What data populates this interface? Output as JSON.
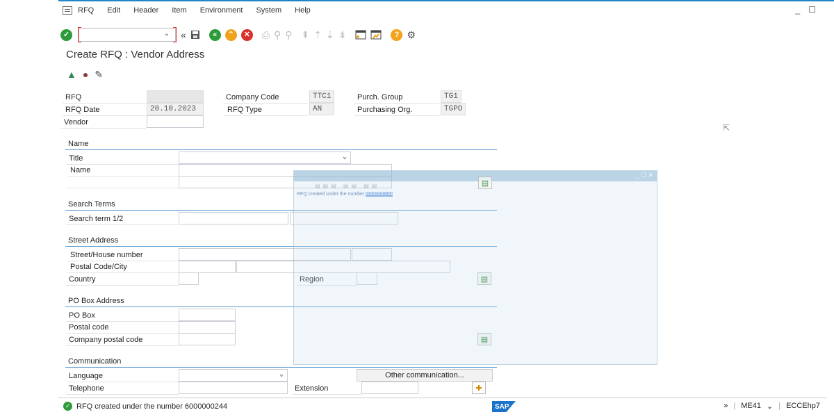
{
  "menu": [
    "RFQ",
    "Edit",
    "Header",
    "Item",
    "Environment",
    "System",
    "Help"
  ],
  "window_controls": [
    "_",
    "☐"
  ],
  "toolbar": {
    "command_field_value": "",
    "icons": [
      "enter-icon",
      "back-icon",
      "save-icon",
      "back-green-icon",
      "exit-icon",
      "cancel-icon",
      "print-icon",
      "find-icon",
      "find-next-icon",
      "first-page-icon",
      "prev-page-icon",
      "next-page-icon",
      "last-page-icon",
      "new-session-icon",
      "shortcut-icon",
      "help-icon",
      "customize-icon"
    ]
  },
  "page_title": "Create RFQ : Vendor Address",
  "header": {
    "rfq_label": "RFQ",
    "rfq_value": "",
    "rfq_date_label": "RFQ Date",
    "rfq_date_value": "20.10.2023",
    "vendor_label": "Vendor",
    "vendor_value": "",
    "company_code_label": "Company Code",
    "company_code_value": "TTC1",
    "rfq_type_label": "RFQ Type",
    "rfq_type_value": "AN",
    "purch_group_label": "Purch. Group",
    "purch_group_value": "TG1",
    "purch_org_label": "Purchasing Org.",
    "purch_org_value": "TGPO"
  },
  "sections": {
    "name": {
      "title": "Name",
      "title_label": "Title",
      "name_label": "Name"
    },
    "search_terms": {
      "title": "Search Terms",
      "search_term_label": "Search term 1/2"
    },
    "street_address": {
      "title": "Street Address",
      "street_label": "Street/House number",
      "postal_city_label": "Postal Code/City",
      "country_label": "Country",
      "region_label": "Region"
    },
    "po_box": {
      "title": "PO Box Address",
      "po_box_label": "PO Box",
      "postal_code_label": "Postal code",
      "company_postal_label": "Company postal code"
    },
    "communication": {
      "title": "Communication",
      "language_label": "Language",
      "telephone_label": "Telephone",
      "extension_label": "Extension",
      "other_comm_button": "Other communication..."
    }
  },
  "popup": {
    "message_prefix": "RFQ created under the number",
    "message_number": "6000000244"
  },
  "status": {
    "message": "RFQ created under the number 6000000244",
    "transaction": "ME41",
    "system": "ECCEhp7",
    "logo": "SAP"
  }
}
